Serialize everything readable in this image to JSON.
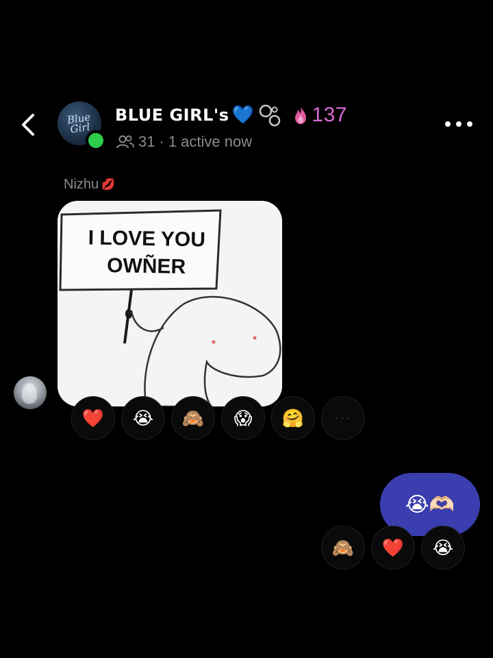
{
  "header": {
    "back_icon": "chevron-left-icon",
    "group_avatar_text": "Blue Girl",
    "group_name": "BLUE GIRL's",
    "group_name_emoji": "💙",
    "group_bubbles_icon": "chat-bubbles-icon",
    "streak_icon": "flame-icon",
    "streak_count": "137",
    "members_icon": "people-icon",
    "member_count": "31",
    "separator": "·",
    "active_status": "1 active now",
    "more_icon": "ellipsis-icon",
    "online_status_color": "#2ecc4b",
    "streak_color": "#d96bd8"
  },
  "messages": {
    "incoming": {
      "sender_name": "Nizhu",
      "sender_emoji": "💋",
      "image_sign_line1": "I LOVE YOU",
      "image_sign_line2": "OWÑER",
      "reactions": [
        "❤️",
        "😭",
        "🙈",
        "😱",
        "🤗"
      ],
      "reactions_more": "···"
    },
    "outgoing": {
      "text": "😭🫶🏻",
      "bubble_color": "#3b3eae",
      "reactions": [
        "🙈",
        "❤️",
        "😭"
      ]
    }
  }
}
